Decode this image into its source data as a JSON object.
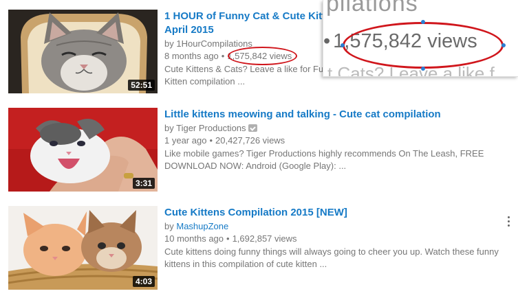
{
  "results": [
    {
      "title_line1": "1 HOUR of Funny Cat & Cute Kitte",
      "title_line2": "April 2015",
      "by_prefix": "by",
      "channel": "1HourCompilations",
      "age": "8 months ago",
      "views": "1,575,842 views",
      "desc_line1": "Cute Kittens & Cats? Leave a like for Fu",
      "desc_line2": "Kitten compilation ...",
      "duration": "52:51"
    },
    {
      "title": "Little kittens meowing and talking - Cute cat compilation",
      "by_prefix": "by",
      "channel": "Tiger Productions",
      "age": "1 year ago",
      "views": "20,427,726 views",
      "desc_line1": "Like mobile games? Tiger Productions highly recommends On The Leash, FREE",
      "desc_line2": "DOWNLOAD NOW: Android (Google Play): ...",
      "duration": "3:31"
    },
    {
      "title": "Cute Kittens Compilation 2015 [NEW]",
      "by_prefix": "by",
      "channel": "MashupZone",
      "age": "10 months ago",
      "views": "1,692,857 views",
      "desc_line1": "Cute kittens doing funny things will always going to cheer you up. Watch these funny",
      "desc_line2": "kittens in this compilation of cute kitten ...",
      "duration": "4:03"
    }
  ],
  "zoom": {
    "top_text": "pilations",
    "dot": "•",
    "views": "1,575,842 views",
    "bottom_text": "t Cats? Leave a like f"
  },
  "separator": "•",
  "colors": {
    "link": "#167ac6",
    "meta": "#767676",
    "highlight": "#d0161c"
  }
}
